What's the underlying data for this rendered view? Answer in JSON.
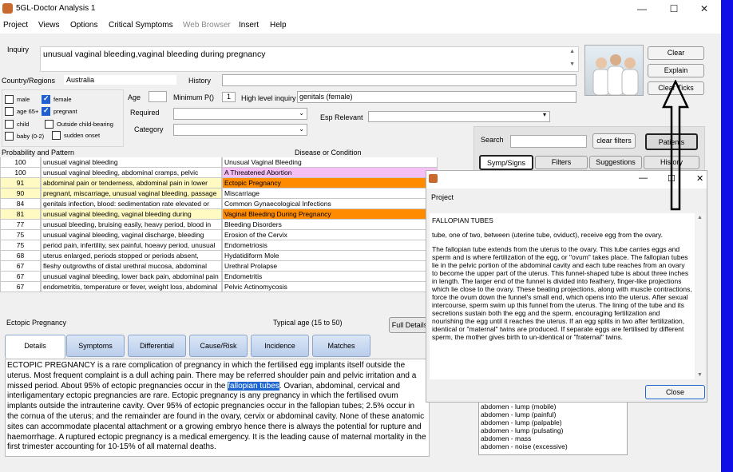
{
  "window": {
    "title": "5GL-Doctor Analysis 1",
    "controls": {
      "minimize": "—",
      "maximize": "☐",
      "close": "✕"
    }
  },
  "menu": [
    "Project",
    "Views",
    "Options",
    "Critical Symptoms",
    "Web Browser",
    "Insert",
    "Help"
  ],
  "inquiry": {
    "label": "Inquiry",
    "value": "unusual vaginal bleeding,vaginal bleeding during pregnancy"
  },
  "country": {
    "label": "Country/Regions",
    "value": "Australia"
  },
  "history": {
    "label": "History",
    "value": ""
  },
  "checkboxes": {
    "male": "male",
    "female": "female",
    "age65": "age 65+",
    "pregnant": "pregnant",
    "child": "child",
    "outside": "Outside child-bearing",
    "baby": "baby (0-2)",
    "sudden": "sudden onset"
  },
  "age": {
    "label": "Age",
    "value": ""
  },
  "min_p": {
    "label": "Minimum P()",
    "value": "1"
  },
  "high_level": {
    "label": "High level inquiry",
    "value": "genitals (female)"
  },
  "required": {
    "label": "Required",
    "value": ""
  },
  "category": {
    "label": "Category",
    "value": ""
  },
  "esp": {
    "label": "Esp Relevant",
    "value": ""
  },
  "buttons": {
    "clear": "Clear",
    "explain": "Explain",
    "clear_ticks": "Clear Ticks",
    "clear_filters": "clear filters",
    "patients": "Patients",
    "full_details": "Full Details",
    "close": "Close"
  },
  "search": {
    "label": "Search",
    "value": ""
  },
  "right_tabs": [
    "Symp/Signs",
    "Filters",
    "Suggestions",
    "History"
  ],
  "grid": {
    "headers": {
      "probability": "Probability and Pattern",
      "disease": "Disease or Condition"
    },
    "rows": [
      {
        "p": "100",
        "pattern": "unusual vaginal bleeding",
        "disease": "Unusual Vaginal Bleeding",
        "bg": "#ffffff",
        "dbg": "#ffffff"
      },
      {
        "p": "100",
        "pattern": "unusual vaginal bleeding, abdominal cramps, pelvic",
        "disease": "A Threatened Abortion",
        "bg": "#ffffff",
        "dbg": "#f6c0f6"
      },
      {
        "p": "91",
        "pattern": "abdominal pain or tenderness, abdominal pain in lower",
        "disease": "Ectopic Pregnancy",
        "bg": "#fff9c2",
        "dbg": "#ff8c00"
      },
      {
        "p": "90",
        "pattern": "pregnant, miscarriage, unusual vaginal bleeding, passage",
        "disease": "Miscarriage",
        "bg": "#fff9c2",
        "dbg": "#ffffff"
      },
      {
        "p": "84",
        "pattern": "genitals infection, blood: sedimentation rate elevated or",
        "disease": "Common Gynaecological Infections",
        "bg": "#ffffff",
        "dbg": "#ffffff"
      },
      {
        "p": "81",
        "pattern": "unusual vaginal bleeding, vaginal bleeding during",
        "disease": "Vaginal Bleeding During Pregnancy",
        "bg": "#fff9c2",
        "dbg": "#ff8c00"
      },
      {
        "p": "77",
        "pattern": "unusual bleeding, bruising easily, heavy period, blood in",
        "disease": "Bleeding Disorders",
        "bg": "#ffffff",
        "dbg": "#ffffff"
      },
      {
        "p": "75",
        "pattern": "unusual vaginal bleeding, vaginal discharge, bleeding",
        "disease": "Erosion of the Cervix",
        "bg": "#ffffff",
        "dbg": "#ffffff"
      },
      {
        "p": "75",
        "pattern": "period pain, infertility, sex painful, hoeavy period, unusual",
        "disease": "Endometriosis",
        "bg": "#ffffff",
        "dbg": "#ffffff"
      },
      {
        "p": "68",
        "pattern": "uterus enlarged, periods stopped or periods absent,",
        "disease": "Hydatidiform Mole",
        "bg": "#ffffff",
        "dbg": "#ffffff"
      },
      {
        "p": "67",
        "pattern": "fleshy outgrowths of distal urethral mucosa, abdominal",
        "disease": "Urethral Prolapse",
        "bg": "#ffffff",
        "dbg": "#ffffff"
      },
      {
        "p": "67",
        "pattern": "unusual vaginal bleeding, lower back pain, abdominal pain",
        "disease": "Endometritis",
        "bg": "#ffffff",
        "dbg": "#ffffff"
      },
      {
        "p": "67",
        "pattern": "endometritis, temperature or fever, weight loss, abdominal",
        "disease": "Pelvic Actinomycosis",
        "bg": "#ffffff",
        "dbg": "#ffffff"
      }
    ]
  },
  "detail": {
    "condition": "Ectopic Pregnancy",
    "typical_age": "Typical age (15 to 50)",
    "tabs": [
      "Details",
      "Symptoms",
      "Differential",
      "Cause/Risk",
      "Incidence",
      "Matches"
    ],
    "text_before": "ECTOPIC PREGNANCY is a rare complication of pregnancy in which the fertilised egg implants itself outside the uterus. Most frequent complaint is a dull aching pain. There may be referred shoulder pain and pelvic irritation and a missed period. About 95% of ectopic pregnancies occur in the ",
    "text_highlight": "fallopian tubes",
    "text_after": ". Ovarian, abdominal, cervical and interligamentary ectopic pregnancies are rare.  Ectopic pregnancy is any pregnancy in which the fertilised ovum implants outside the intrauterine cavity. Over 95% of ectopic pregnancies occur in the fallopian tubes;  2.5% occur in the cornua of the uterus; and the remainder are found in the ovary, cervix or abdominal cavity. None of these anatomic sites can accommodate placental attachment or a growing embryo hence there is always the potential for rupture and haemorrhage. A ruptured ectopic pregnancy is a medical emergency. It is the leading cause of maternal mortality in the first trimester accounting for 10-15% of all maternal deaths."
  },
  "popup": {
    "title": "Project",
    "heading": "FALLOPIAN TUBES",
    "para1": "tube, one of two, between (uterine tube, oviduct), receive egg from the ovary.",
    "para2": "The fallopian tube extends from the uterus to the ovary. This tube carries eggs and sperm and is where fertilization of the egg, or \"ovum\" takes place. The fallopian tubes lie in the pelvic portion of the abdominal cavity and each tube reaches from an ovary to become the upper part of the uterus. This funnel-shaped tube is about three inches in length. The larger end of the funnel is divided into feathery, finger-like projections which lie close to the ovary. These beating projections, along with muscle contractions, force the ovum down the funnel's small end, which opens into the uterus. After sexual intercourse, sperm swim up this funnel from the uterus. The lining of the tube and its secretions sustain both the egg and the sperm, encouraging fertilization and nourishing the egg until it reaches the uterus. If an egg splits in two after fertilization, identical or \"maternal\" twins are produced. If separate eggs are fertilised by different sperm, the mother gives birth to un-identical or \"fraternal\" twins."
  },
  "symptom_list": [
    "abdomen - lump (mobile)",
    "abdomen - lump (painful)",
    "abdomen - lump (palpable)",
    "abdomen - lump (pulsating)",
    "abdomen - mass",
    "abdomen - noise (excessive)"
  ],
  "colors": {
    "accent_blue": "#1f66d1",
    "border_blue": "#0f0fe6",
    "orange": "#ff8c00",
    "pink": "#f6c0f6",
    "yellow": "#fff9c2"
  }
}
